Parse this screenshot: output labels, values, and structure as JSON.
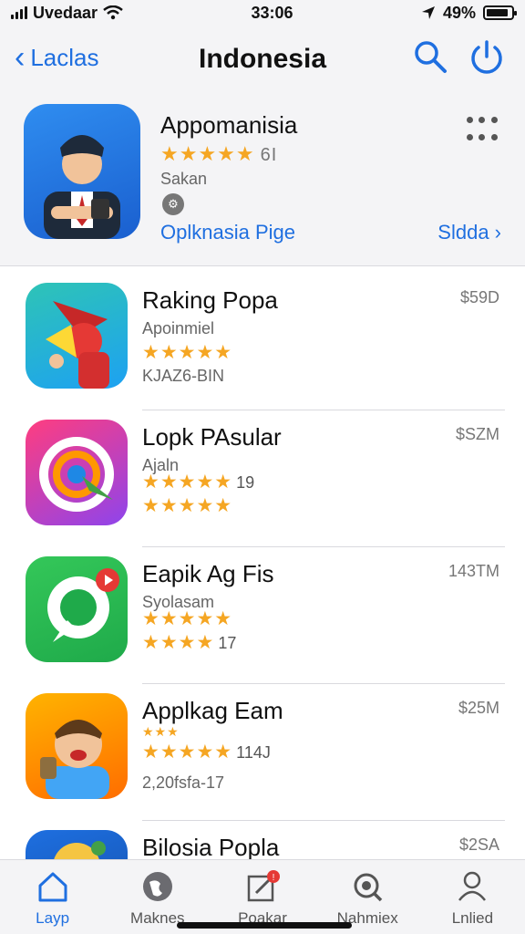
{
  "status_bar": {
    "carrier": "Uvedaar",
    "time": "33:06",
    "battery_percent": "49%",
    "signal_icon": "signal-bars-icon",
    "wifi_icon": "wifi-icon",
    "location_icon": "location-arrow-icon"
  },
  "nav": {
    "back_label": "Laclas",
    "title": "Indonesia",
    "search_icon": "search-icon",
    "power_icon": "power-icon"
  },
  "featured": {
    "title": "Appomanisia",
    "stars": "★★★★★",
    "rating_count": "6I",
    "subtitle": "Sakan",
    "link": "Oplknasia Pige",
    "action": "Sldda ›"
  },
  "apps": [
    {
      "name": "Raking Popa",
      "line1": "Apoinmiel",
      "stars1": "★★★★★",
      "line2": "KJAZ6-BIN",
      "price": "$59D"
    },
    {
      "name": "Lopk PAsular",
      "line1": "Ajaln",
      "stars1": "★★★★★",
      "stars1_num": "19",
      "stars2": "★★★★★",
      "price": "$SZM"
    },
    {
      "name": "Eapik Ag Fis",
      "line1": "Syolasam",
      "stars1": "★★★★★",
      "stars2": "★★★★",
      "stars2_num": "17",
      "price": "143TM"
    },
    {
      "name": "Applkag Eam",
      "line1": "★★★",
      "stars1": "★★★★★",
      "stars1_num": "114J",
      "line2": "2,20fsfa-17",
      "price": "$25M"
    },
    {
      "name": "Bilosia Popla",
      "price": "$2SA"
    }
  ],
  "tabs": [
    {
      "label": "Layp",
      "icon": "home-icon",
      "active": true
    },
    {
      "label": "Maknes",
      "icon": "globe-icon",
      "active": false
    },
    {
      "label": "Poakar",
      "icon": "edit-icon",
      "active": false
    },
    {
      "label": "Nahmiex",
      "icon": "magnifier-icon",
      "active": false
    },
    {
      "label": "Lnlied",
      "icon": "person-icon",
      "active": false
    }
  ],
  "colors": {
    "accent": "#1f6fe0",
    "star": "#f5a623",
    "badge": "#e53935"
  }
}
